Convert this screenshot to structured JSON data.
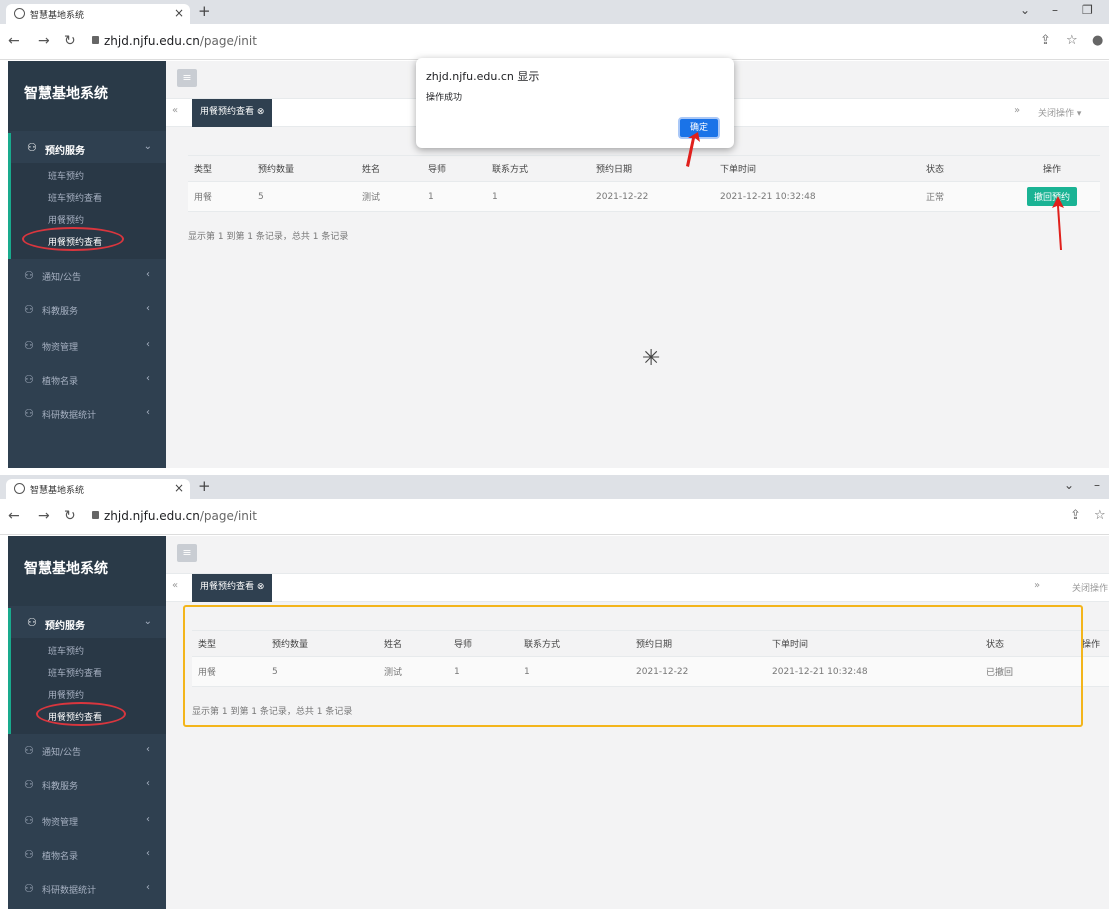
{
  "browser": {
    "tab_title": "智慧基地系统",
    "tab_close": "×",
    "new_tab": "+",
    "url_host": "zhjd.njfu.edu.cn",
    "url_path": "/page/init"
  },
  "sidebar": {
    "brand": "智慧基地系统",
    "groups": [
      {
        "label": "预约服务",
        "items": [
          "班车预约",
          "班车预约查看",
          "用餐预约",
          "用餐预约查看"
        ]
      },
      {
        "label": "通知/公告"
      },
      {
        "label": "科教服务"
      },
      {
        "label": "物资管理"
      },
      {
        "label": "植物名录"
      },
      {
        "label": "科研数据统计"
      }
    ]
  },
  "content": {
    "active_tab": "用餐预约查看",
    "close_ops": "关闭操作",
    "columns": [
      "类型",
      "预约数量",
      "姓名",
      "导师",
      "联系方式",
      "预约日期",
      "下单时间",
      "状态",
      "操作"
    ],
    "row_before": [
      "用餐",
      "5",
      "测试",
      "1",
      "1",
      "2021-12-22",
      "2021-12-21 10:32:48",
      "正常"
    ],
    "row_after": [
      "用餐",
      "5",
      "测试",
      "1",
      "1",
      "2021-12-22",
      "2021-12-21 10:32:48",
      "已撤回"
    ],
    "revoke_button": "撤回预约",
    "summary": "显示第 1 到第 1 条记录，总共 1 条记录"
  },
  "dialog": {
    "title": "zhjd.njfu.edu.cn 显示",
    "message": "操作成功",
    "ok": "确定"
  },
  "colors": {
    "sidebar": "#2f4050",
    "accent": "#1ab394",
    "dialog_button": "#1a73e8",
    "highlight_box": "#f3b51b",
    "annotation_red": "#d9363e"
  }
}
